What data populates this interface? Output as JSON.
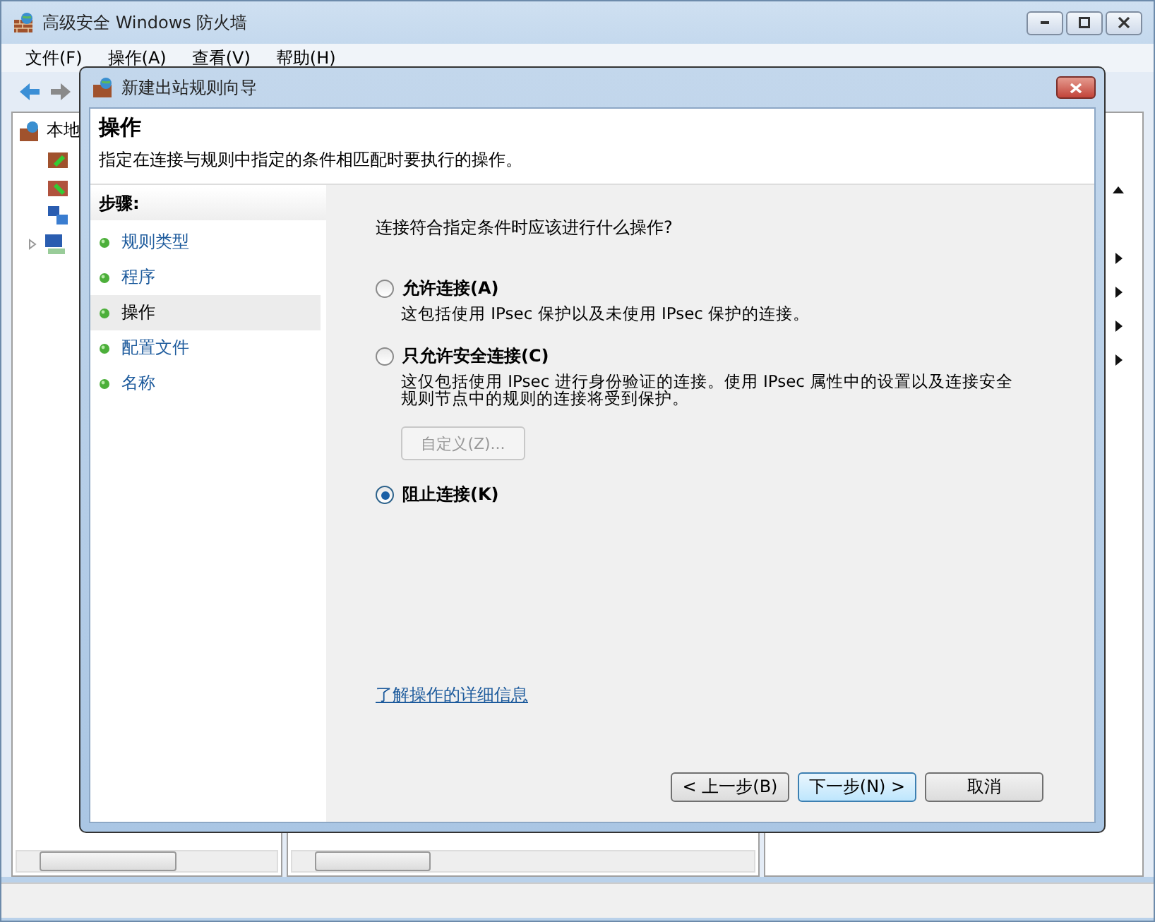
{
  "main_window": {
    "title": "高级安全 Windows 防火墙",
    "menu": [
      "文件(F)",
      "操作(A)",
      "查看(V)",
      "帮助(H)"
    ],
    "tree_root": "本地"
  },
  "dialog": {
    "title": "新建出站规则向导",
    "heading": "操作",
    "description": "指定在连接与规则中指定的条件相匹配时要执行的操作。",
    "steps_label": "步骤:",
    "steps": [
      {
        "label": "规则类型",
        "selected": false
      },
      {
        "label": "程序",
        "selected": false
      },
      {
        "label": "操作",
        "selected": true
      },
      {
        "label": "配置文件",
        "selected": false
      },
      {
        "label": "名称",
        "selected": false
      }
    ],
    "question": "连接符合指定条件时应该进行什么操作?",
    "options": [
      {
        "label": "允许连接(A)",
        "description": "这包括使用 IPsec 保护以及未使用 IPsec 保护的连接。",
        "selected": false
      },
      {
        "label": "只允许安全连接(C)",
        "description": "这仅包括使用 IPsec 进行身份验证的连接。使用 IPsec 属性中的设置以及连接安全规则节点中的规则的连接将受到保护。",
        "selected": false,
        "button": {
          "label": "自定义(Z)...",
          "disabled": true
        }
      },
      {
        "label": "阻止连接(K)",
        "selected": true
      }
    ],
    "link": "了解操作的详细信息",
    "buttons": [
      {
        "label": "< 上一步(B)",
        "default": false
      },
      {
        "label": "下一步(N) >",
        "default": true
      },
      {
        "label": "取消",
        "default": false
      }
    ]
  }
}
